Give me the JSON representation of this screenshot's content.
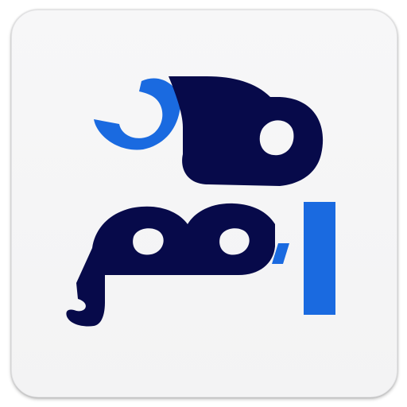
{
  "app": {
    "logo_text": "مدابزار",
    "colors": {
      "navy": "#070a4a",
      "blue": "#1a6ae0",
      "tile_background": "#f4f4f5"
    },
    "icon": "mod-abzar-logo-icon"
  }
}
